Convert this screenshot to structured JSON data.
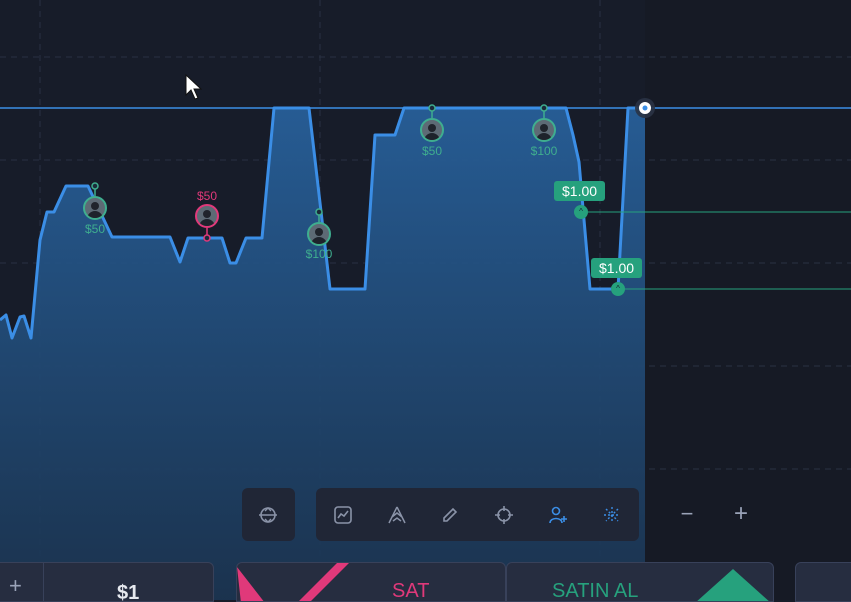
{
  "chart": {
    "line_color": "#3b8ee6",
    "current_price_line_color": "#3b8ee6",
    "trades": [
      {
        "amount": "$50",
        "side": "buy"
      },
      {
        "amount": "$50",
        "side": "sell"
      },
      {
        "amount": "$100",
        "side": "buy"
      },
      {
        "amount": "$50",
        "side": "buy"
      },
      {
        "amount": "$100",
        "side": "buy"
      }
    ],
    "price_markers": [
      {
        "label": "$1.00"
      },
      {
        "label": "$1.00"
      }
    ]
  },
  "toolbar": {
    "tools": [
      {
        "icon": "chart-type-icon",
        "active": false
      },
      {
        "icon": "indicators-icon",
        "active": false
      },
      {
        "icon": "drawing-pen-icon",
        "active": false
      },
      {
        "icon": "crosshair-icon",
        "active": false
      },
      {
        "icon": "social-trading-icon",
        "active": true
      },
      {
        "icon": "sparkle-icon",
        "active": true
      }
    ],
    "left_tool_icon": "chart-layout-icon",
    "zoom_out": "−",
    "zoom_in": "+"
  },
  "bottom": {
    "add_label": "+",
    "amount_value": "$1",
    "sell_label": "SAT",
    "buy_label": "SATIN AL",
    "sell_color": "#e0397a",
    "buy_color": "#26a17d"
  }
}
